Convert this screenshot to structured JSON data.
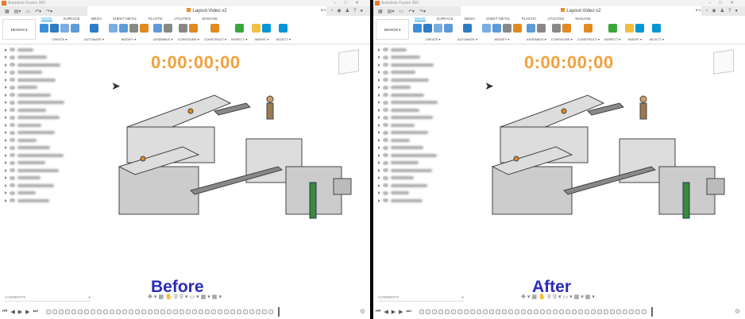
{
  "panes": [
    {
      "app_title": "Autodesk Fusion 360",
      "doc_title": "Layout-Video v2",
      "timer": "0:00:00;00",
      "caption": "Before"
    },
    {
      "app_title": "Autodesk Fusion 360",
      "doc_title": "Layout-Video v2",
      "timer": "0:00:00;00",
      "caption": "After"
    }
  ],
  "ribbon": {
    "workspace": "DESIGN ▾",
    "tabs": [
      "SOLID",
      "SURFACE",
      "MESH",
      "SHEET METAL",
      "PLASTIC",
      "UTILITIES",
      "MANAGE"
    ],
    "groups": [
      {
        "label": "CREATE ▾",
        "icons": 4
      },
      {
        "label": "AUTOMATE ▾",
        "icons": 1
      },
      {
        "label": "MODIFY ▾",
        "icons": 4
      },
      {
        "label": "ASSEMBLE ▾",
        "icons": 2
      },
      {
        "label": "CONFIGURE ▾",
        "icons": 2
      },
      {
        "label": "CONSTRUCT ▾",
        "icons": 1
      },
      {
        "label": "INSPECT ▾",
        "icons": 1
      },
      {
        "label": "INSERT ▾",
        "icons": 2
      },
      {
        "label": "SELECT ▾",
        "icons": 1
      }
    ]
  },
  "panels": {
    "comments": "COMMENTS"
  },
  "colors": {
    "accent": "#0696d7",
    "timer": "#f4a03a",
    "caption": "#2b2bb8"
  }
}
